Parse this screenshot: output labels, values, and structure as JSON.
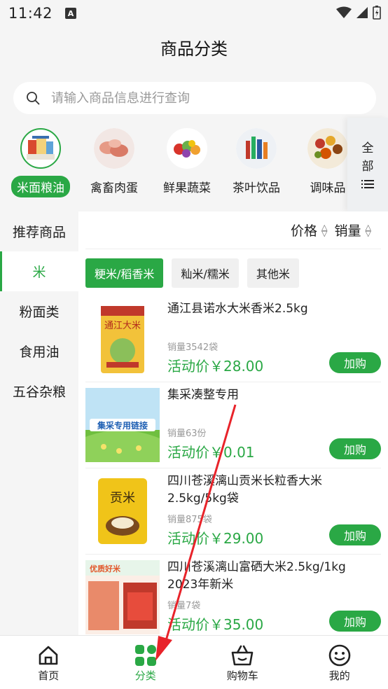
{
  "status": {
    "time": "11:42",
    "badge": "A"
  },
  "header": {
    "title": "商品分类"
  },
  "search": {
    "placeholder": "请输入商品信息进行查询"
  },
  "categories": [
    {
      "label": "米面粮油",
      "icon": "grain-oil-icon",
      "active": true
    },
    {
      "label": "禽畜肉蛋",
      "icon": "meat-icon",
      "active": false
    },
    {
      "label": "鲜果蔬菜",
      "icon": "vegetables-icon",
      "active": false
    },
    {
      "label": "茶叶饮品",
      "icon": "drinks-icon",
      "active": false
    },
    {
      "label": "调味品",
      "icon": "spices-icon",
      "active": false
    }
  ],
  "all_button": {
    "line1": "全",
    "line2": "部",
    "icon": "list-icon"
  },
  "left_nav": [
    {
      "label": "推荐商品",
      "active": false
    },
    {
      "label": "米",
      "active": true
    },
    {
      "label": "粉面类",
      "active": false
    },
    {
      "label": "食用油",
      "active": false
    },
    {
      "label": "五谷杂粮",
      "active": false
    }
  ],
  "sort": {
    "price": "价格",
    "sales": "销量"
  },
  "subtabs": [
    {
      "label": "粳米/稻香米",
      "active": true
    },
    {
      "label": "籼米/糯米",
      "active": false
    },
    {
      "label": "其他米",
      "active": false
    }
  ],
  "products": [
    {
      "name": "通江县诺水大米香米2.5kg",
      "sales": "销量3542袋",
      "price": "活动价￥28.00",
      "button": "加购",
      "thumb": "rice-bag-yellow"
    },
    {
      "name": "集采凑整专用",
      "sales": "销量63份",
      "price": "活动价￥0.01",
      "button": "加购",
      "thumb": "banner-green",
      "thumb_text": "集采专用链接"
    },
    {
      "name": "四川苍溪漓山贡米长粒香大米2.5kg/5kg袋",
      "sales": "销量875袋",
      "price": "活动价￥29.00",
      "button": "加购",
      "thumb": "rice-bag-gongmi",
      "thumb_text": "贡米"
    },
    {
      "name": "四川苍溪漓山富硒大米2.5kg/1kg 2023年新米",
      "sales": "销量7袋",
      "price": "活动价￥35.00",
      "button": "加购",
      "thumb": "rice-box-red",
      "thumb_text": "优质好米"
    }
  ],
  "tabbar": [
    {
      "label": "首页",
      "icon": "home-icon",
      "active": false
    },
    {
      "label": "分类",
      "icon": "category-grid-icon",
      "active": true
    },
    {
      "label": "购物车",
      "icon": "cart-basket-icon",
      "active": false
    },
    {
      "label": "我的",
      "icon": "smiley-profile-icon",
      "active": false
    }
  ],
  "colors": {
    "accent": "#2aa845",
    "annotation": "#e8232a"
  }
}
